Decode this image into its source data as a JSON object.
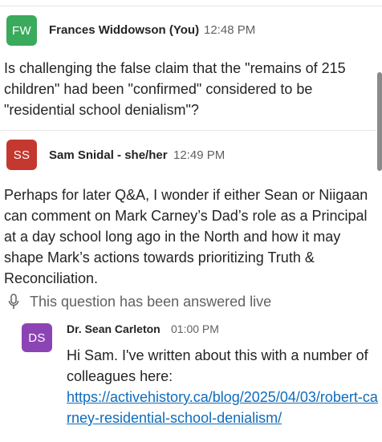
{
  "messages": [
    {
      "initials": "FW",
      "avatar_color": "#3aaa5c",
      "name": "Frances Widdowson (You)",
      "time": "12:48 PM",
      "text": "Is challenging the false claim that the \"remains of 215 children\" had been \"confirmed\" considered to be \"residential school denialism\"?"
    },
    {
      "initials": "SS",
      "avatar_color": "#c4382f",
      "name": "Sam Snidal - she/her",
      "time": "12:49 PM",
      "text": "Perhaps for later Q&A, I wonder if either Sean or Niigaan can comment on Mark Carney’s Dad’s role as a Principal at a day school long ago in the North and how it may shape Mark’s actions towards prioritizing Truth & Reconciliation."
    }
  ],
  "answered_label": "This question has been answered live",
  "answered_icon": "microphone-icon",
  "reply": {
    "initials": "DS",
    "avatar_color": "#8c44b5",
    "name": "Dr. Sean Carleton",
    "time": "01:00 PM",
    "text": "Hi Sam. I've written about this with a number of colleagues here:",
    "link": "https://activehistory.ca/blog/2025/04/03/robert-carney-residential-school-denialism/"
  }
}
